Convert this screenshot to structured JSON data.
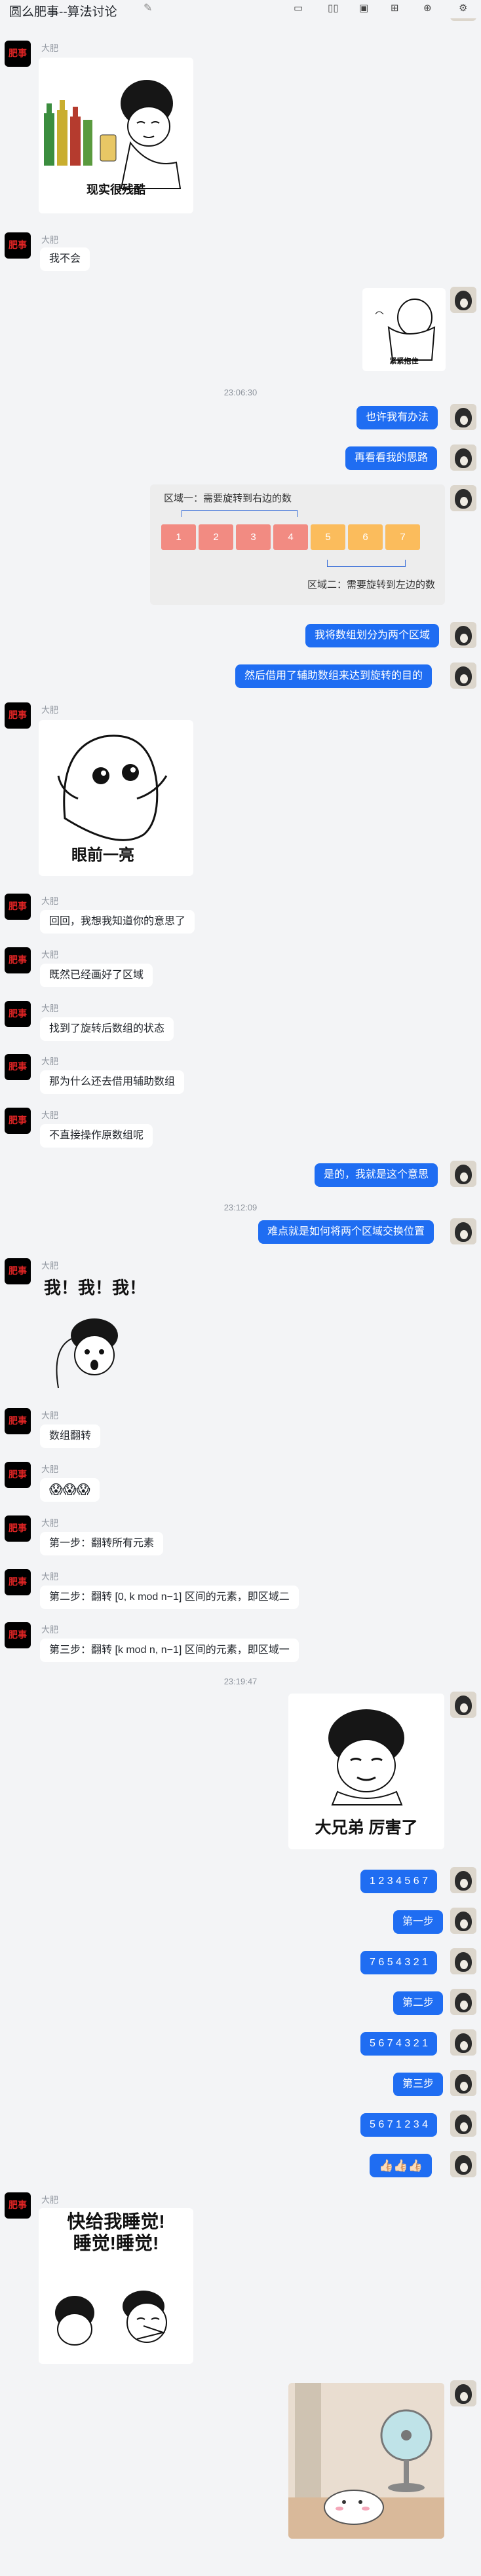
{
  "header": {
    "title": "圆么肥事--算法讨论",
    "icons": [
      "folder-icon",
      "book-icon",
      "image-icon",
      "grid-icon",
      "add-icon",
      "settings-icon"
    ]
  },
  "sender_left_name": "大肥",
  "avatar_left_text": "肥事",
  "images": {
    "reality_cruel": "现实很残酷",
    "nervous": "紧紧抱住",
    "eyes_bright": "眼前一亮",
    "me_me_me": "我！我！我！",
    "big_brother": "大兄弟 厉害了",
    "sleep": "快给我睡觉!\n睡觉!睡觉!"
  },
  "timestamps": {
    "t1": "23:06:30",
    "t2": "23:12:09",
    "t3": "23:19:47"
  },
  "diagram": {
    "region1_label": "区域一：需要旋转到右边的数",
    "region2_label": "区域二：需要旋转到左边的数",
    "cells": [
      "1",
      "2",
      "3",
      "4",
      "5",
      "6",
      "7"
    ]
  },
  "messages": {
    "m_no": "我不会",
    "r_maybe": "也许我有办法",
    "r_look": "再看看我的思路",
    "r_split": "我将数组划分为两个区域",
    "r_aux": "然后借用了辅助数组来达到旋转的目的",
    "l_hui": "回回，我想我知道你的意思了",
    "l_already": "既然已经画好了区域",
    "l_found": "找到了旋转后数组的状态",
    "l_why": "那为什么还去借用辅助数组",
    "l_direct": "不直接操作原数组呢",
    "r_yes": "是的，我就是这个意思",
    "r_difficult": "难点就是如何将两个区域交换位置",
    "l_reverse": "数组翻转",
    "l_emoji": "😱😱😱",
    "l_step1": "第一步：翻转所有元素",
    "l_step2": "第二步：翻转 [0, k mod n−1] 区间的元素，即区域二",
    "l_step3": "第三步：翻转 [k  mod  n,  n−1] 区间的元素，即区域一",
    "r_seq1": "1 2 3 4 5 6 7",
    "r_step1": "第一步",
    "r_seq2": "7 6 5 4 3 2 1",
    "r_step2": "第二步",
    "r_seq3": "5 6 7 4 3 2 1",
    "r_step3": "第三步",
    "r_seq4": "5 6 7 1 2 3 4",
    "r_thumbs": "👍🏻👍🏻👍🏻"
  },
  "colors": {
    "accent": "#1f6df2",
    "region1": "#f28b82",
    "region2": "#fbbc5c"
  }
}
